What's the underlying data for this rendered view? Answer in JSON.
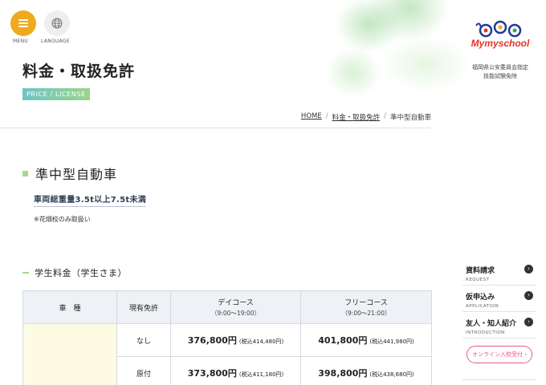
{
  "nav": {
    "menu_label": "MENU",
    "language_label": "LANGUAGE"
  },
  "header": {
    "title": "料金・取扱免許",
    "badge": "PRICE / LICENSE"
  },
  "logo": {
    "brand": "Mymyschool",
    "sub_line1": "福岡県公安委員会指定",
    "sub_line2": "技能試験免除"
  },
  "breadcrumb": {
    "items": [
      "HOME",
      "料金・取扱免許",
      "準中型自動車"
    ],
    "separator": "/"
  },
  "section": {
    "title": "準中型自動車",
    "weight": "車両総重量3.5t以上7.5t未満",
    "note": "※花畑校のみ取扱い"
  },
  "student_fees": {
    "heading": "学生料金（学生さま）",
    "headers": {
      "car_type": "車　種",
      "license": "現有免許",
      "day_course": "デイコース",
      "day_range": "（9:00〜19:00）",
      "free_course": "フリーコース",
      "free_range": "（9:00〜21:00）"
    },
    "rows": [
      {
        "license": "なし",
        "day_price": "376,800円",
        "day_tax": "(税込414,480円)",
        "free_price": "401,800円",
        "free_tax": "(税込441,980円)"
      },
      {
        "license": "原付",
        "day_price": "373,800円",
        "day_tax": "(税込411,180円)",
        "free_price": "398,800円",
        "free_tax": "(税込438,680円)"
      }
    ]
  },
  "sidebar": {
    "items": [
      {
        "label": "資料請求",
        "en": "REQUEST"
      },
      {
        "label": "仮申込み",
        "en": "APPLICATION"
      },
      {
        "label": "友人・知人紹介",
        "en": "INTRODUCTION"
      }
    ],
    "online_button": "オンライン入校受付 ›",
    "arrow_glyph": "›"
  },
  "colors": {
    "menu_orange": "#f0a81e",
    "accent_green": "#a8d88a",
    "pink": "#e75a8a"
  }
}
